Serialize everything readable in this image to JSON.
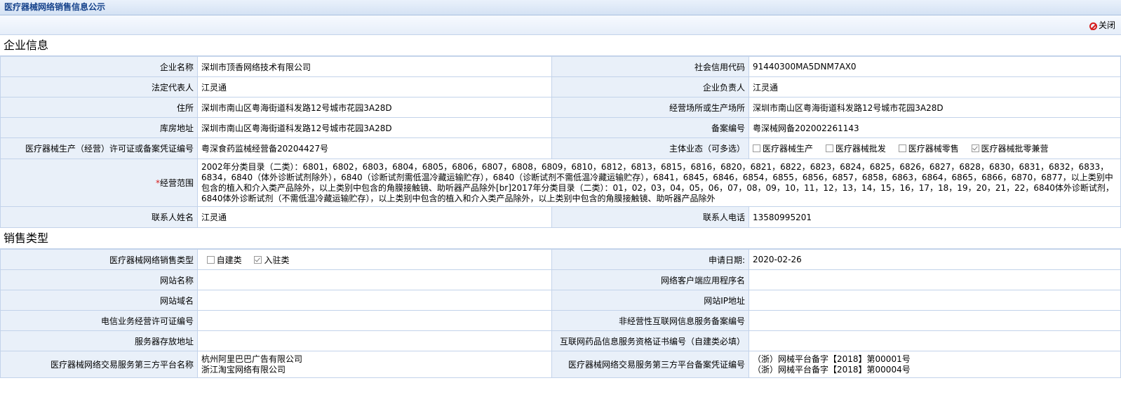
{
  "window": {
    "title": "医疗器械网络销售信息公示"
  },
  "toolbar": {
    "close_label": "关闭"
  },
  "company": {
    "section_title": "企业信息",
    "rows": [
      {
        "label": "企业名称",
        "value": "深圳市顶香网络技术有限公司",
        "label2": "社会信用代码",
        "value2": "91440300MA5DNM7AX0"
      },
      {
        "label": "法定代表人",
        "value": "江灵通",
        "label2": "企业负责人",
        "value2": "江灵通"
      },
      {
        "label": "住所",
        "value": "深圳市南山区粤海街道科发路12号城市花园3A28D",
        "label2": "经营场所或生产场所",
        "value2": "深圳市南山区粤海街道科发路12号城市花园3A28D"
      },
      {
        "label": "库房地址",
        "value": "深圳市南山区粤海街道科发路12号城市花园3A28D",
        "label2": "备案编号",
        "value2": "粤深械网备202002261143"
      }
    ],
    "license_label": "医疗器械生产（经营）许可证或备案凭证编号",
    "license_value": "粤深食药监械经营备20204427号",
    "entity_label": "主体业态（可多选）",
    "entity_options": [
      {
        "label": "医疗器械生产",
        "checked": false
      },
      {
        "label": "医疗器械批发",
        "checked": false
      },
      {
        "label": "医疗器械零售",
        "checked": false
      },
      {
        "label": "医疗器械批零兼营",
        "checked": true
      }
    ],
    "scope_required_mark": "*",
    "scope_label": "经营范围",
    "scope_value": "2002年分类目录（二类）：6801，6802，6803，6804，6805，6806，6807，6808，6809，6810，6812，6813，6815，6816，6820，6821，6822，6823，6824，6825，6826，6827，6828，6830，6831，6832，6833，6834，6840（体外诊断试剂除外），6840（诊断试剂需低温冷藏运输贮存），6840（诊断试剂不需低温冷藏运输贮存），6841，6845，6846，6854，6855，6856，6857，6858，6863，6864，6865，6866，6870，6877，以上类别中包含的植入和介入类产品除外，以上类别中包含的角膜接触镜、助听器产品除外[br]2017年分类目录（二类）：01，02，03，04，05，06，07，08，09，10，11，12，13，14，15，16，17，18，19，20，21，22，6840体外诊断试剂，6840体外诊断试剂（不需低温冷藏运输贮存），以上类别中包含的植入和介入类产品除外，以上类别中包含的角膜接触镜、助听器产品除外",
    "contact_label": "联系人姓名",
    "contact_value": "江灵通",
    "phone_label": "联系人电话",
    "phone_value": "13580995201"
  },
  "sales": {
    "section_title": "销售类型",
    "type_label": "医疗器械网络销售类型",
    "type_options": [
      {
        "label": "自建类",
        "checked": false
      },
      {
        "label": "入驻类",
        "checked": true
      }
    ],
    "date_label": "申请日期:",
    "date_value": "2020-02-26",
    "rows": [
      {
        "label": "网站名称",
        "value": "",
        "label2": "网络客户端应用程序名",
        "value2": ""
      },
      {
        "label": "网站域名",
        "value": "",
        "label2": "网站IP地址",
        "value2": ""
      },
      {
        "label": "电信业务经营许可证编号",
        "value": "",
        "label2": "非经营性互联网信息服务备案编号",
        "value2": ""
      },
      {
        "label": "服务器存放地址",
        "value": "",
        "label2": "互联网药品信息服务资格证书编号（自建类必填）",
        "value2": ""
      }
    ],
    "platform_label": "医疗器械网络交易服务第三方平台名称",
    "platform_values": [
      "杭州阿里巴巴广告有限公司",
      "浙江淘宝网络有限公司"
    ],
    "platform_cert_label": "医疗器械网络交易服务第三方平台备案凭证编号",
    "platform_cert_values": [
      "（浙）网械平台备字【2018】第00001号",
      "（浙）网械平台备字【2018】第00004号"
    ]
  }
}
